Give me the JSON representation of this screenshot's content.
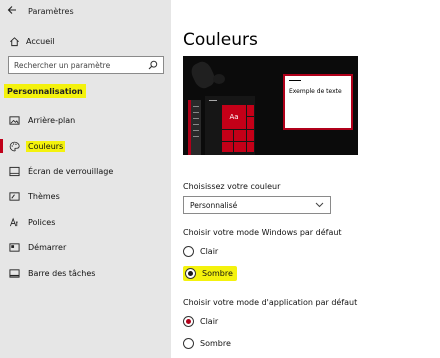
{
  "window": {
    "title": "Paramètres",
    "back_icon": "back-arrow-icon"
  },
  "sidebar": {
    "home": {
      "label": "Accueil",
      "icon": "home-icon"
    },
    "search": {
      "placeholder": "Rechercher un paramètre",
      "icon": "search-icon"
    },
    "section_title": "Personnalisation",
    "items": [
      {
        "label": "Arrière-plan",
        "icon": "picture-icon",
        "active": false
      },
      {
        "label": "Couleurs",
        "icon": "palette-icon",
        "active": true
      },
      {
        "label": "Écran de verrouillage",
        "icon": "lock-screen-icon",
        "active": false
      },
      {
        "label": "Thèmes",
        "icon": "brush-icon",
        "active": false
      },
      {
        "label": "Polices",
        "icon": "fonts-icon",
        "active": false
      },
      {
        "label": "Démarrer",
        "icon": "start-icon",
        "active": false
      },
      {
        "label": "Barre des tâches",
        "icon": "taskbar-icon",
        "active": false
      }
    ]
  },
  "main": {
    "title": "Couleurs",
    "preview": {
      "tile_label": "Aa",
      "sample_text": "Exemple de texte"
    },
    "color_choice": {
      "label": "Choisissez votre couleur",
      "value": "Personnalisé"
    },
    "windows_mode": {
      "label": "Choisir votre mode Windows par défaut",
      "options": [
        {
          "label": "Clair",
          "selected": false
        },
        {
          "label": "Sombre",
          "selected": true
        }
      ]
    },
    "app_mode": {
      "label": "Choisir votre mode d'application par défaut",
      "options": [
        {
          "label": "Clair",
          "selected": true
        },
        {
          "label": "Sombre",
          "selected": false
        }
      ]
    }
  },
  "colors": {
    "accent": "#b0001a",
    "highlight": "#f4f20d",
    "sidebar_bg": "#e6e6e6"
  }
}
